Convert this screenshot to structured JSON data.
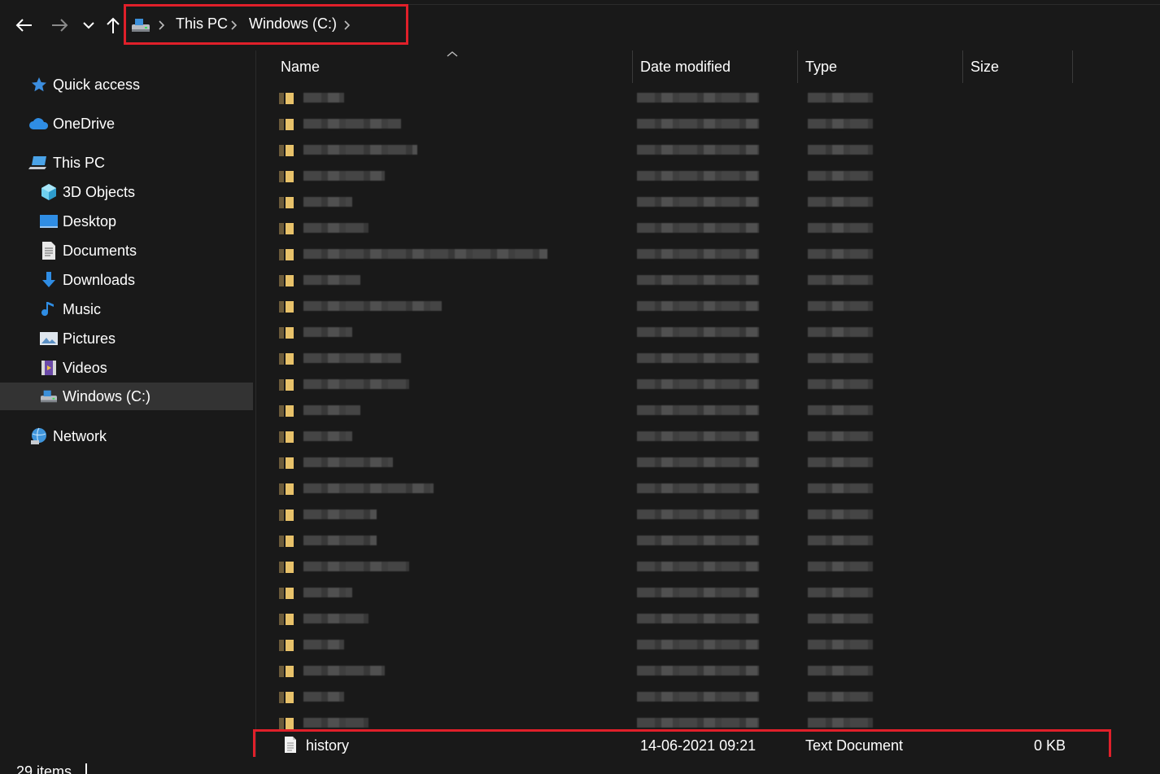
{
  "breadcrumb": {
    "items": [
      {
        "label": "This PC"
      },
      {
        "label": "Windows (C:)"
      }
    ]
  },
  "sidebar": {
    "items": [
      {
        "label": "Quick access",
        "icon": "star-icon"
      },
      {
        "label": "OneDrive",
        "icon": "cloud-icon"
      },
      {
        "label": "This PC",
        "icon": "computer-icon"
      },
      {
        "label": "3D Objects",
        "icon": "cube-icon"
      },
      {
        "label": "Desktop",
        "icon": "desktop-icon"
      },
      {
        "label": "Documents",
        "icon": "document-icon"
      },
      {
        "label": "Downloads",
        "icon": "download-icon"
      },
      {
        "label": "Music",
        "icon": "music-icon"
      },
      {
        "label": "Pictures",
        "icon": "pictures-icon"
      },
      {
        "label": "Videos",
        "icon": "videos-icon"
      },
      {
        "label": "Windows (C:)",
        "icon": "drive-icon",
        "selected": true
      },
      {
        "label": "Network",
        "icon": "network-icon"
      }
    ]
  },
  "columns": {
    "name": "Name",
    "date": "Date modified",
    "type": "Type",
    "size": "Size"
  },
  "file": {
    "name": "history",
    "date": "14-06-2021 09:21",
    "type": "Text Document",
    "size": "0 KB"
  },
  "status": {
    "count": "29 items"
  },
  "colors": {
    "background": "#191919",
    "highlight": "#e0202a",
    "selected": "#333333",
    "folder": "#e8c26a"
  }
}
